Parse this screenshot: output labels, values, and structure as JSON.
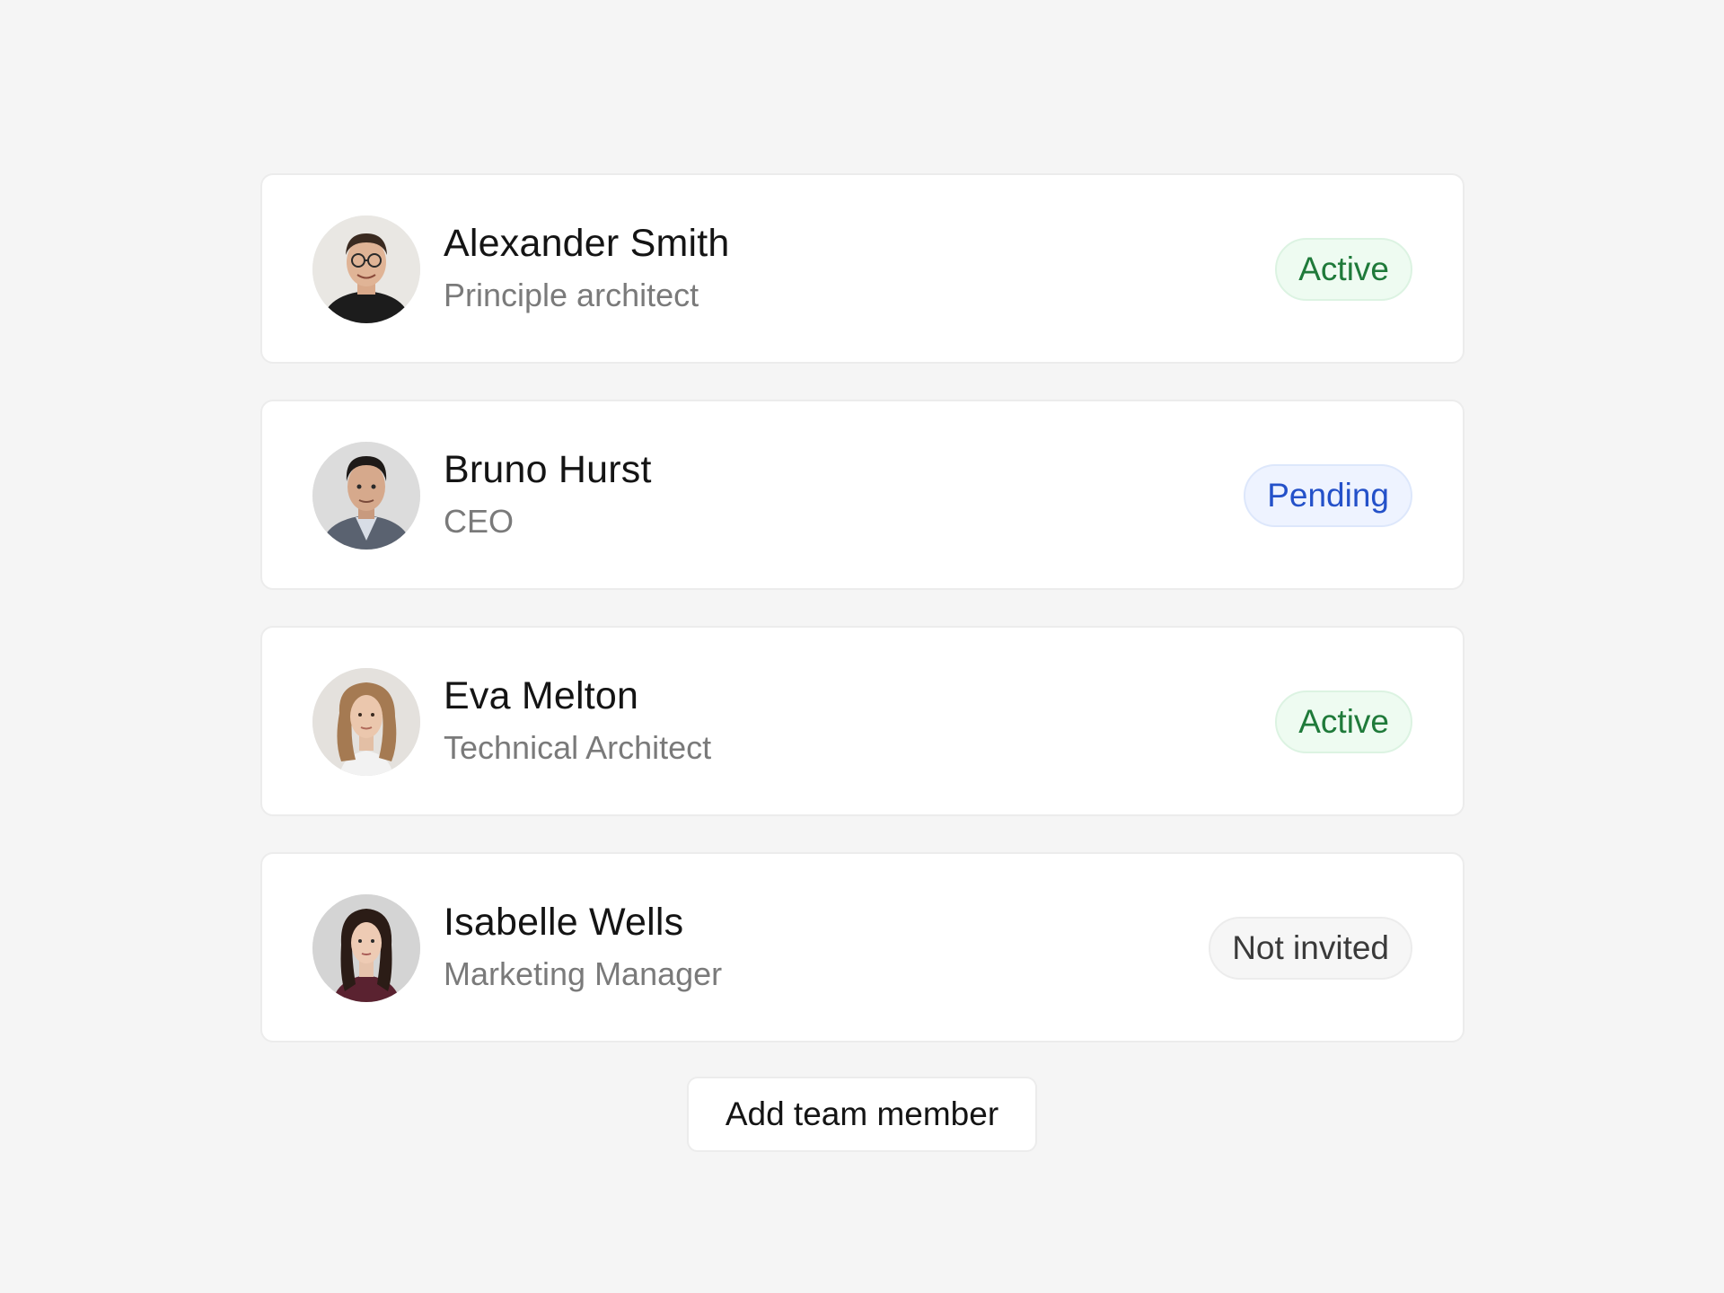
{
  "members": [
    {
      "name": "Alexander Smith",
      "role": "Principle architect",
      "status": "Active",
      "status_kind": "active",
      "status_color": "#1f7a3a",
      "avatar_icon": "man-glasses-photo"
    },
    {
      "name": "Bruno Hurst",
      "role": "CEO",
      "status": "Pending",
      "status_kind": "pending",
      "status_color": "#2451c9",
      "avatar_icon": "man-suit-photo"
    },
    {
      "name": "Eva Melton",
      "role": "Technical Architect",
      "status": "Active",
      "status_kind": "active",
      "status_color": "#1f7a3a",
      "avatar_icon": "woman-wavy-hair-photo"
    },
    {
      "name": "Isabelle Wells",
      "role": "Marketing Manager",
      "status": "Not invited",
      "status_kind": "notinvited",
      "status_color": "#3a3a3a",
      "avatar_icon": "woman-dark-hair-photo"
    }
  ],
  "add_button_label": "Add team member"
}
